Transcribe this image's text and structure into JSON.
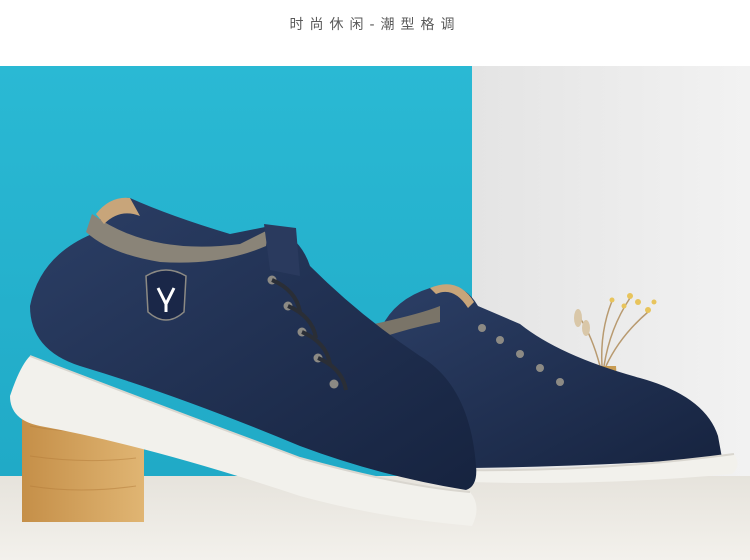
{
  "header": {
    "title": "时尚休闲-潮型格调"
  },
  "photo": {
    "description_icon": "shoe-photo",
    "colors": {
      "teal_wall": "#27b8d2",
      "light_wall": "#ececec",
      "floor": "#dcdad4",
      "shoe_leather": "#1f2f52",
      "shoe_sole": "#f2f1ec",
      "wood_block": "#d2a25d",
      "vase": "#c79b52"
    }
  }
}
